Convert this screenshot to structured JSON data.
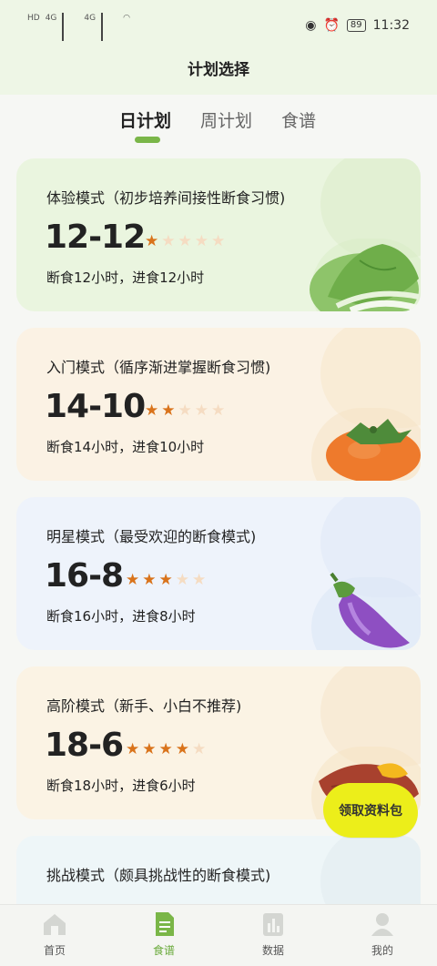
{
  "status_bar": {
    "left_labels": [
      "HD",
      "HD"
    ],
    "network": [
      "4G",
      "4G"
    ],
    "battery": "89",
    "time": "11:32"
  },
  "header": {
    "title": "计划选择"
  },
  "tabs": [
    {
      "label": "日计划",
      "active": true
    },
    {
      "label": "周计划",
      "active": false
    },
    {
      "label": "食谱",
      "active": false
    }
  ],
  "plans": [
    {
      "subtitle": "体验模式（初步培养间接性断食习惯)",
      "ratio": "12-12",
      "stars": 1,
      "max_stars": 5,
      "desc": "断食12小时，进食12小时",
      "bg": "#eaf5df",
      "accent": "#d9ecc6",
      "icon": "bok-choy-icon"
    },
    {
      "subtitle": "入门模式（循序渐进掌握断食习惯)",
      "ratio": "14-10",
      "stars": 2,
      "max_stars": 5,
      "desc": "断食14小时，进食10小时",
      "bg": "#fbf2e4",
      "accent": "#f6e4c6",
      "icon": "persimmon-icon"
    },
    {
      "subtitle": "明星模式（最受欢迎的断食模式)",
      "ratio": "16-8",
      "stars": 3,
      "max_stars": 5,
      "desc": "断食16小时，进食8小时",
      "bg": "#eef3fb",
      "accent": "#dbe6f6",
      "icon": "eggplant-icon"
    },
    {
      "subtitle": "高阶模式（新手、小白不推荐)",
      "ratio": "18-6",
      "stars": 4,
      "max_stars": 5,
      "desc": "断食18小时，进食6小时",
      "bg": "#fbf3e4",
      "accent": "#f5e3c5",
      "icon": "sweet-potato-icon"
    },
    {
      "subtitle": "挑战模式（颇具挑战性的断食模式)",
      "ratio": "",
      "stars": 0,
      "max_stars": 5,
      "desc": "",
      "bg": "#eef6f8",
      "accent": "#dde9ee",
      "icon": ""
    }
  ],
  "promo": {
    "label": "领取资料包"
  },
  "bottom_nav": [
    {
      "label": "首页",
      "icon": "home-icon",
      "active": false
    },
    {
      "label": "食谱",
      "icon": "recipe-icon",
      "active": true
    },
    {
      "label": "数据",
      "icon": "data-chart-icon",
      "active": false
    },
    {
      "label": "我的",
      "icon": "profile-icon",
      "active": false
    }
  ],
  "colors": {
    "accent_green": "#7ab648",
    "star_on": "#d9731b",
    "star_off": "#f5dcc2",
    "promo": "#ecee1a"
  }
}
